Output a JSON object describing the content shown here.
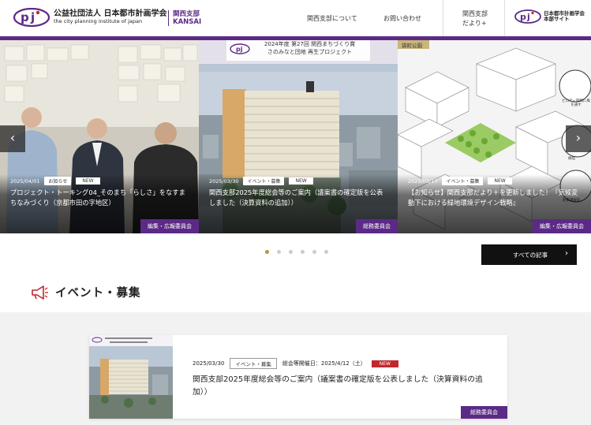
{
  "header": {
    "org_jp": "公益社団法人 日本都市計画学会",
    "org_en": "the city planning institute of japan",
    "branch_line1": "関西支部",
    "branch_line2": "KANSAI",
    "nav": {
      "about": "関西支部について",
      "contact": "お問い合わせ",
      "dayori_line1": "関西支部",
      "dayori_line2": "だより+"
    },
    "hq_line1": "日本都市計画学会",
    "hq_line2": "本部サイト"
  },
  "slides": [
    {
      "date": "2025/04/01",
      "category": "お知らせ",
      "badge": "NEW",
      "title": "プロジェクト・トーキング04_そのまち「らしさ」をなすまちなみづくり（京都市田の字地区）",
      "committee": "編集・広報委員会"
    },
    {
      "date": "2025/03/30",
      "category": "イベント・募集",
      "badge": "NEW",
      "title": "関西支部2025年度総会等のご案内（議案書の確定版を公表しました（決算資料の追加））",
      "committee": "総務委員会",
      "banner_line1": "2024年度 第27回 関西まちづくり賞",
      "banner_line2": "さのみなと団地 再生プロジェクト"
    },
    {
      "date": "2025/03/17",
      "category": "イベント・募集",
      "badge": "NEW",
      "title": "【お知らせ】関西支部だより＋を更新しました！『気候変動下における緑地環境デザイン戦略』",
      "committee": "編集・広報委員会",
      "image_label": "袋町公園",
      "callout1": "ビロティ空間に風を通す",
      "callout2": "緑陰",
      "callout3": "駐車場緑化"
    }
  ],
  "carousel": {
    "dot_count": 6,
    "active_index": 0
  },
  "all_articles_label": "すべての記事",
  "section": {
    "title": "イベント・募集"
  },
  "event_card": {
    "date": "2025/03/30",
    "category": "イベント・募集",
    "meeting_date": "総会等開催日：2025/4/12（土）",
    "badge": "NEW",
    "title": "関西支部2025年度総会等のご案内（議案書の確定版を公表しました（決算資料の追加））",
    "committee": "総務委員会"
  },
  "colors": {
    "brand_purple": "#5b2a86",
    "new_red": "#c0282d",
    "active_dot": "#b8924a"
  }
}
